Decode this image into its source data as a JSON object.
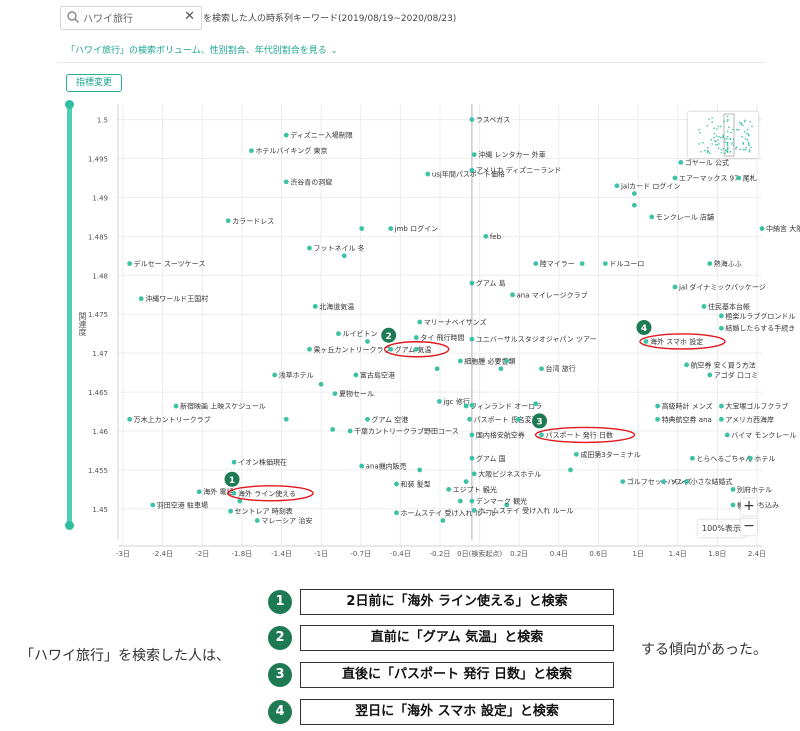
{
  "search": {
    "value": "ハワイ旅行",
    "clear_icon": "close-icon",
    "search_icon": "search-icon"
  },
  "header_text": "を検索した人の時系列キーワード(2019/08/19~2020/08/23)",
  "sub_link": "「ハワイ旅行」の検索ボリューム、性別割合、年代別割合を見る",
  "metric_button": "指標変更",
  "zoom_label": "100%表示",
  "zoom_in": "+",
  "zoom_out": "−",
  "summary": {
    "lead": "「ハワイ旅行」を検索した人は、",
    "tail": "する傾向があった。",
    "findings": [
      {
        "num": "1",
        "text": "2日前に「海外 ライン使える」と検索"
      },
      {
        "num": "2",
        "text": "直前に「グアム 気温」と検索"
      },
      {
        "num": "3",
        "text": "直後に「パスポート 発行 日数」と検索"
      },
      {
        "num": "4",
        "text": "翌日に「海外 スマホ 設定」と検索"
      }
    ]
  },
  "colors": {
    "accent": "#3cc2a4",
    "point": "#3cc2a4",
    "circle": "#e0181e",
    "badge": "#1e7a52"
  },
  "chart_data": {
    "type": "scatter",
    "ylabel": "関連度",
    "xlim": [
      -3.05,
      2.5
    ],
    "ylim": [
      1.446,
      1.502
    ],
    "x_ticks": [
      -3.0,
      -2.6,
      -2.2,
      -1.8,
      -1.4,
      -1.0,
      -0.6,
      -0.2,
      0.0,
      0.2,
      0.6,
      1.0,
      1.4,
      1.8,
      2.2
    ],
    "x_tick_labels": [
      "-3日",
      "-2.4日",
      "-2日",
      "-1.8日",
      "-1.4日",
      "-1日",
      "-0.7日",
      "-0.4日",
      "-0.2日",
      "0日(検索起点)",
      "0.2日",
      "0.4日",
      "0.6日",
      "1日",
      "1.4日",
      "1.8日",
      "2.4日"
    ],
    "y_ticks": [
      1.45,
      1.455,
      1.46,
      1.465,
      1.47,
      1.475,
      1.48,
      1.485,
      1.49,
      1.495,
      1.5
    ],
    "y_tick_labels": [
      "1.45",
      "1.455",
      "1.46",
      "1.465",
      "1.47",
      "1.475",
      "1.48",
      "1.485",
      "1.49",
      "1.495",
      "1.5"
    ],
    "points": [
      {
        "x": -1.6,
        "y": 1.498,
        "label": "ディズニー入場制限"
      },
      {
        "x": -1.9,
        "y": 1.496,
        "label": "ホテルバイキング 東京"
      },
      {
        "x": -1.6,
        "y": 1.492,
        "label": "渋谷青の洞窟"
      },
      {
        "x": -2.1,
        "y": 1.487,
        "label": "カラードレス"
      },
      {
        "x": -2.95,
        "y": 1.4815,
        "label": "デルセー スーツケース"
      },
      {
        "x": -2.85,
        "y": 1.477,
        "label": "沖縄ワールド王国村"
      },
      {
        "x": -1.4,
        "y": 1.4835,
        "label": "フットネイル 冬"
      },
      {
        "x": -1.1,
        "y": 1.4825,
        "label": ""
      },
      {
        "x": -0.95,
        "y": 1.486,
        "label": ""
      },
      {
        "x": -0.7,
        "y": 1.486,
        "label": "jmb ログイン"
      },
      {
        "x": -0.38,
        "y": 1.493,
        "label": "usj年間パスポート価格"
      },
      {
        "x": -1.35,
        "y": 1.476,
        "label": "北海道気温"
      },
      {
        "x": -1.15,
        "y": 1.4725,
        "label": "ルイビトン"
      },
      {
        "x": -1.4,
        "y": 1.4705,
        "label": "果ヶ丘カントリークラブ"
      },
      {
        "x": -0.9,
        "y": 1.4715,
        "label": ""
      },
      {
        "x": -1.7,
        "y": 1.4672,
        "label": "浅草ホテル"
      },
      {
        "x": -1.0,
        "y": 1.4672,
        "label": "富古島空港"
      },
      {
        "x": -1.3,
        "y": 1.466,
        "label": ""
      },
      {
        "x": -1.18,
        "y": 1.4648,
        "label": "夏物セール"
      },
      {
        "x": -2.55,
        "y": 1.4632,
        "label": "新宿映画 上映スケジュール"
      },
      {
        "x": -2.95,
        "y": 1.4615,
        "label": "万木上カントリークラブ"
      },
      {
        "x": -1.6,
        "y": 1.4615,
        "label": ""
      },
      {
        "x": -1.2,
        "y": 1.4602,
        "label": ""
      },
      {
        "x": -0.9,
        "y": 1.4615,
        "label": "グアム 空港"
      },
      {
        "x": -1.05,
        "y": 1.46,
        "label": "千葉カントリークラブ野田コース"
      },
      {
        "x": -2.05,
        "y": 1.456,
        "label": "イオン株価現在"
      },
      {
        "x": -0.95,
        "y": 1.4555,
        "label": "ana機内販売"
      },
      {
        "x": -2.35,
        "y": 1.4522,
        "label": "海外 電話"
      },
      {
        "x": -2.75,
        "y": 1.4505,
        "label": "羽田空港 駐車場"
      },
      {
        "x": -2.08,
        "y": 1.4497,
        "label": "セントレア 時刻表"
      },
      {
        "x": -1.85,
        "y": 1.4485,
        "label": "マレーシア 治安"
      },
      {
        "x": -2.0,
        "y": 1.451,
        "label": ""
      },
      {
        "x": -0.65,
        "y": 1.4532,
        "label": "和装 髪型"
      },
      {
        "x": -0.65,
        "y": 1.4495,
        "label": "ホームステイ 受け入れ ルール"
      },
      {
        "x": -0.2,
        "y": 1.4525,
        "label": "エジプト 観光"
      },
      {
        "x": -0.25,
        "y": 1.4485,
        "label": ""
      },
      {
        "x": -0.1,
        "y": 1.451,
        "label": ""
      },
      {
        "x": 0.02,
        "y": 1.4498,
        "label": "ホームステイ 受け入れ ルール"
      },
      {
        "x": 0.3,
        "y": 1.4505,
        "label": ""
      },
      {
        "x": -0.45,
        "y": 1.455,
        "label": ""
      },
      {
        "x": 0.0,
        "y": 1.5,
        "label": "ラスベガス"
      },
      {
        "x": 0.02,
        "y": 1.4955,
        "label": "沖縄 レンタカー 外車"
      },
      {
        "x": 0.0,
        "y": 1.4935,
        "label": "アメリカ ディズニーランド"
      },
      {
        "x": 0.12,
        "y": 1.485,
        "label": "feb"
      },
      {
        "x": 0.55,
        "y": 1.4815,
        "label": "陸マイラー"
      },
      {
        "x": 1.15,
        "y": 1.4815,
        "label": "ドルユーロ"
      },
      {
        "x": 0.95,
        "y": 1.4815,
        "label": ""
      },
      {
        "x": 0.0,
        "y": 1.479,
        "label": "グアム 島"
      },
      {
        "x": 0.35,
        "y": 1.4775,
        "label": "ana マイレージクラブ"
      },
      {
        "x": -0.45,
        "y": 1.474,
        "label": "マリーナベイサンズ"
      },
      {
        "x": -0.48,
        "y": 1.472,
        "label": "タイ 飛行時間"
      },
      {
        "x": 0.0,
        "y": 1.4718,
        "label": "ユニバーサルスタジオジャパン ツアー"
      },
      {
        "x": -0.48,
        "y": 1.4705,
        "label": ""
      },
      {
        "x": -0.1,
        "y": 1.469,
        "label": "細胞腫 必要書類"
      },
      {
        "x": 0.3,
        "y": 1.469,
        "label": ""
      },
      {
        "x": 0.6,
        "y": 1.468,
        "label": "台湾 旅行"
      },
      {
        "x": 0.25,
        "y": 1.468,
        "label": ""
      },
      {
        "x": -0.3,
        "y": 1.468,
        "label": ""
      },
      {
        "x": -0.28,
        "y": 1.4638,
        "label": "jgc 修行"
      },
      {
        "x": -0.05,
        "y": 1.4632,
        "label": "フィンランド オーロラ"
      },
      {
        "x": 0.0,
        "y": 1.4633,
        "label": ""
      },
      {
        "x": -0.02,
        "y": 1.4615,
        "label": "パスポート 氏名変更"
      },
      {
        "x": 0.0,
        "y": 1.4595,
        "label": "国内格安航空券"
      },
      {
        "x": 0.4,
        "y": 1.4615,
        "label": ""
      },
      {
        "x": 0.55,
        "y": 1.4635,
        "label": ""
      },
      {
        "x": 0.6,
        "y": 1.4595,
        "label": "パスポート 発行 日数"
      },
      {
        "x": 0.0,
        "y": 1.4565,
        "label": "グアム 国"
      },
      {
        "x": 0.02,
        "y": 1.4545,
        "label": "大阪ビジネスホテル"
      },
      {
        "x": -0.05,
        "y": 1.4535,
        "label": ""
      },
      {
        "x": 0.9,
        "y": 1.457,
        "label": "成田第3ターミナル"
      },
      {
        "x": 0.85,
        "y": 1.455,
        "label": ""
      },
      {
        "x": 0.0,
        "y": 1.451,
        "label": "デンマーク 観光"
      },
      {
        "x": 1.3,
        "y": 1.4535,
        "label": "ゴルフセット メンズ"
      },
      {
        "x": 1.65,
        "y": 1.4535,
        "label": "ハワイ"
      },
      {
        "x": 1.85,
        "y": 1.4535,
        "label": "小さな結婚式"
      },
      {
        "x": 1.6,
        "y": 1.4632,
        "label": "高級時計 メンズ"
      },
      {
        "x": 1.6,
        "y": 1.4615,
        "label": "特典航空券 ana"
      },
      {
        "x": 2.15,
        "y": 1.4632,
        "label": "大宝塚ゴルフクラブ"
      },
      {
        "x": 2.15,
        "y": 1.4615,
        "label": "アメリカ西海岸"
      },
      {
        "x": 2.2,
        "y": 1.4595,
        "label": "バイマ モンクレール"
      },
      {
        "x": 1.9,
        "y": 1.4565,
        "label": "とらへるごちゃん"
      },
      {
        "x": 2.4,
        "y": 1.4565,
        "label": "ホテル"
      },
      {
        "x": 2.25,
        "y": 1.4525,
        "label": "別府ホテル"
      },
      {
        "x": 2.25,
        "y": 1.4505,
        "label": "機内持ち込み"
      },
      {
        "x": 1.5,
        "y": 1.4715,
        "label": "海外 スマホ 設定"
      },
      {
        "x": 1.85,
        "y": 1.4685,
        "label": "航空券 安く買う方法"
      },
      {
        "x": 2.05,
        "y": 1.4672,
        "label": "アゴダ 口コミ"
      },
      {
        "x": 2.0,
        "y": 1.476,
        "label": "住民基本台帳"
      },
      {
        "x": 2.15,
        "y": 1.4748,
        "label": "極楽ルラブグロンドル"
      },
      {
        "x": 2.15,
        "y": 1.4732,
        "label": "結婚したらする手続き"
      },
      {
        "x": 1.25,
        "y": 1.4915,
        "label": "jalカード ログイン"
      },
      {
        "x": 1.8,
        "y": 1.4945,
        "label": "ゴヤール 公式"
      },
      {
        "x": 1.75,
        "y": 1.4925,
        "label": "エアーマックス 97"
      },
      {
        "x": 2.3,
        "y": 1.4925,
        "label": "尾札"
      },
      {
        "x": 1.55,
        "y": 1.4875,
        "label": "モンクレール 店舗"
      },
      {
        "x": 2.5,
        "y": 1.486,
        "label": "中納言 大阪"
      },
      {
        "x": 2.05,
        "y": 1.4815,
        "label": "熱海ふふ"
      },
      {
        "x": 1.75,
        "y": 1.4785,
        "label": "jal ダイナミックパッケージ"
      },
      {
        "x": 1.4,
        "y": 1.4905,
        "label": ""
      },
      {
        "x": 1.4,
        "y": 1.489,
        "label": ""
      },
      {
        "x": -2.05,
        "y": 1.452,
        "label": "海外 ライン使える"
      },
      {
        "x": -0.7,
        "y": 1.4705,
        "label": "グアム 気温"
      }
    ],
    "highlights": [
      {
        "num": "1",
        "label": "海外 ライン使える"
      },
      {
        "num": "2",
        "label": "グアム 気温"
      },
      {
        "num": "3",
        "label": "パスポート 発行 日数"
      },
      {
        "num": "4",
        "label": "海外 スマホ 設定"
      }
    ]
  }
}
